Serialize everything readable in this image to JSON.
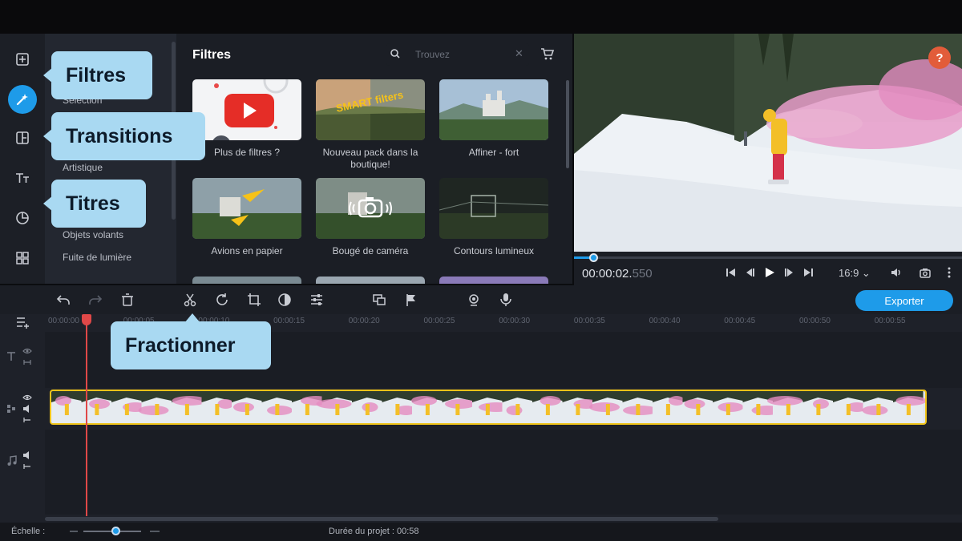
{
  "colors": {
    "accent": "#1e9be9",
    "callout": "#a9d9f2",
    "clip_border": "#f0c419",
    "playhead": "#e04848",
    "help": "#e25c3a"
  },
  "tool_rail": {
    "items": [
      {
        "name": "import",
        "icon": "import-icon"
      },
      {
        "name": "filters",
        "icon": "magic-wand-icon",
        "active": true
      },
      {
        "name": "transitions",
        "icon": "transitions-icon"
      },
      {
        "name": "titles",
        "icon": "text-icon"
      },
      {
        "name": "stickers",
        "icon": "sticker-icon"
      },
      {
        "name": "more",
        "icon": "grid-icon"
      }
    ]
  },
  "categories": [
    "Sélection",
    "Artistique",
    "Objets volants",
    "Fuite de lumière"
  ],
  "filters_panel": {
    "title": "Filtres",
    "search_placeholder": "Trouvez",
    "clear": "✕",
    "tiles": [
      {
        "label": "Plus de filtres ?"
      },
      {
        "label": "Nouveau pack dans la boutique!"
      },
      {
        "label": "Affiner - fort"
      },
      {
        "label": "Avions en papier"
      },
      {
        "label": "Bougé de caméra"
      },
      {
        "label": "Contours lumineux"
      }
    ]
  },
  "smart_tile_text": "SMART filters",
  "help_label": "?",
  "player": {
    "time_main": "00:00:02.",
    "time_ms": "550",
    "ratio": "16:9 ⌄",
    "progress": 0.05
  },
  "export_label": "Exporter",
  "ruler_labels": [
    "00:00:00",
    "00:00:05",
    "00:00:10",
    "00:00:15",
    "00:00:20",
    "00:00:25",
    "00:00:30",
    "00:00:35",
    "00:00:40",
    "00:00:45",
    "00:00:50",
    "00:00:55"
  ],
  "status": {
    "scale_label": "Échelle :",
    "duration_label": "Durée du projet :",
    "duration_value": "00:58",
    "zoom_level": 0.55
  },
  "callouts": {
    "filters": "Filtres",
    "transitions": "Transitions",
    "titles": "Titres",
    "split": "Fractionner"
  }
}
